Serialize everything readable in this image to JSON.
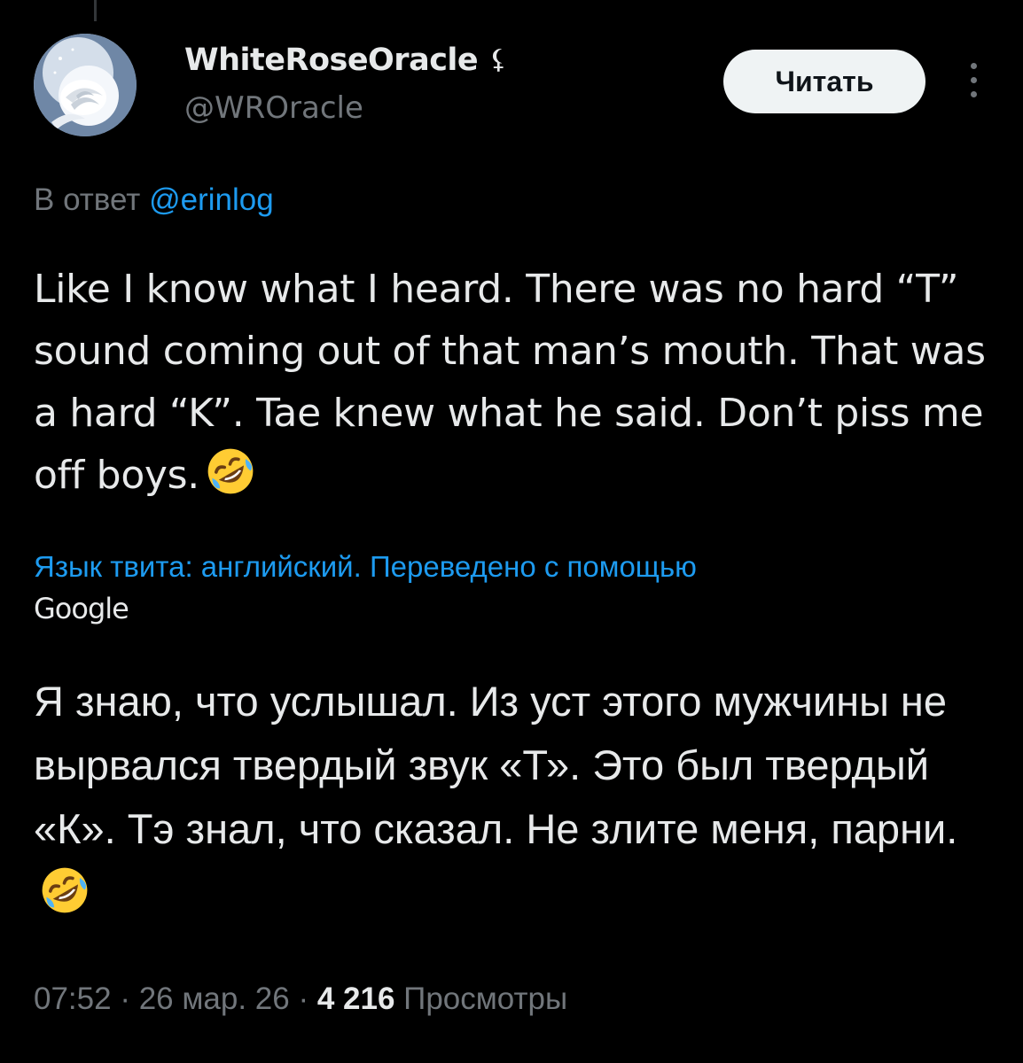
{
  "tweet": {
    "display_name": "WhiteRoseOracle",
    "name_badge": "⚸",
    "handle": "@WROracle",
    "follow_label": "Читать",
    "reply_prefix": "В ответ ",
    "reply_to": "@erinlog",
    "text": "Like I know what I heard. There was no hard “T” sound coming out of that man’s mouth. That was a hard “K”. Tae knew what he said. Don’t piss me off boys.",
    "text_emoji": "rolling-on-floor-laughing-emoji",
    "translation_note": "Язык твита: английский. Переведено с помощью",
    "translation_provider": "Google",
    "translated_text": "Я знаю, что услышал. Из уст этого мужчины не вырвался твердый звук «Т». Это был твердый «К». Тэ знал, что сказал. Не злите меня, парни.",
    "time": "07:52",
    "separator": " · ",
    "date": "26 мар. 26",
    "views_count": "4 216",
    "views_label": " Просмотры"
  },
  "colors": {
    "background": "#000000",
    "primary_text": "#e7e9ea",
    "secondary_text": "#71767b",
    "link": "#1d9bf0",
    "button_bg": "#eff3f4"
  },
  "icons": {
    "more": "vertical-ellipsis-icon",
    "badge": "affiliate-badge-icon"
  }
}
